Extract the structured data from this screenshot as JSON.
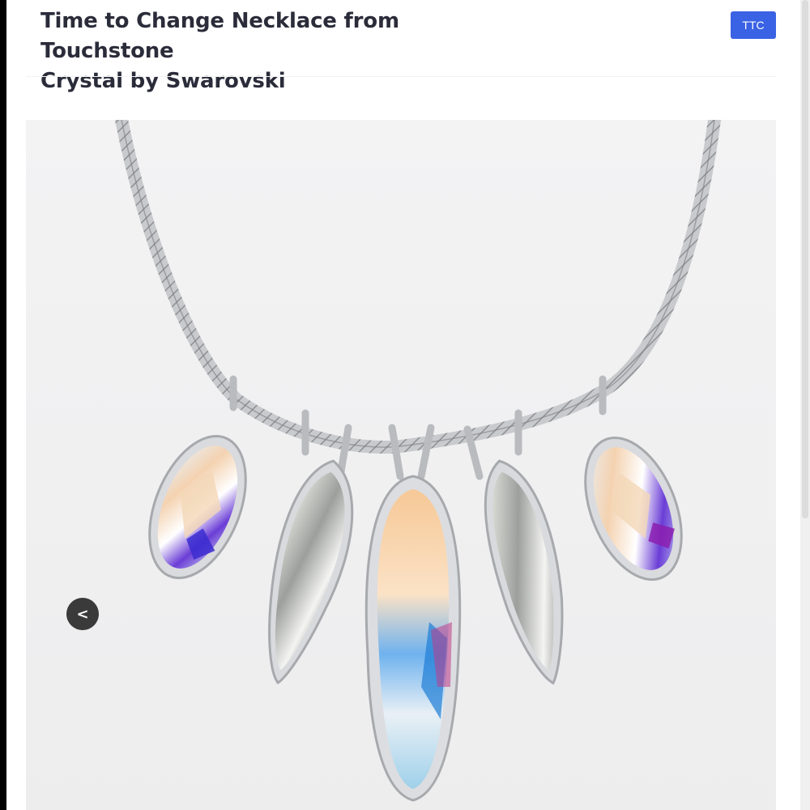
{
  "product": {
    "title_line1": "Time to Change Necklace from Touchstone",
    "title_line2": "Crystal by Swarovski"
  },
  "badge": {
    "label": "TTC",
    "color": "#3a62e4"
  },
  "gallery": {
    "prev_icon": "chevron-left-icon",
    "prev_label": "<"
  }
}
